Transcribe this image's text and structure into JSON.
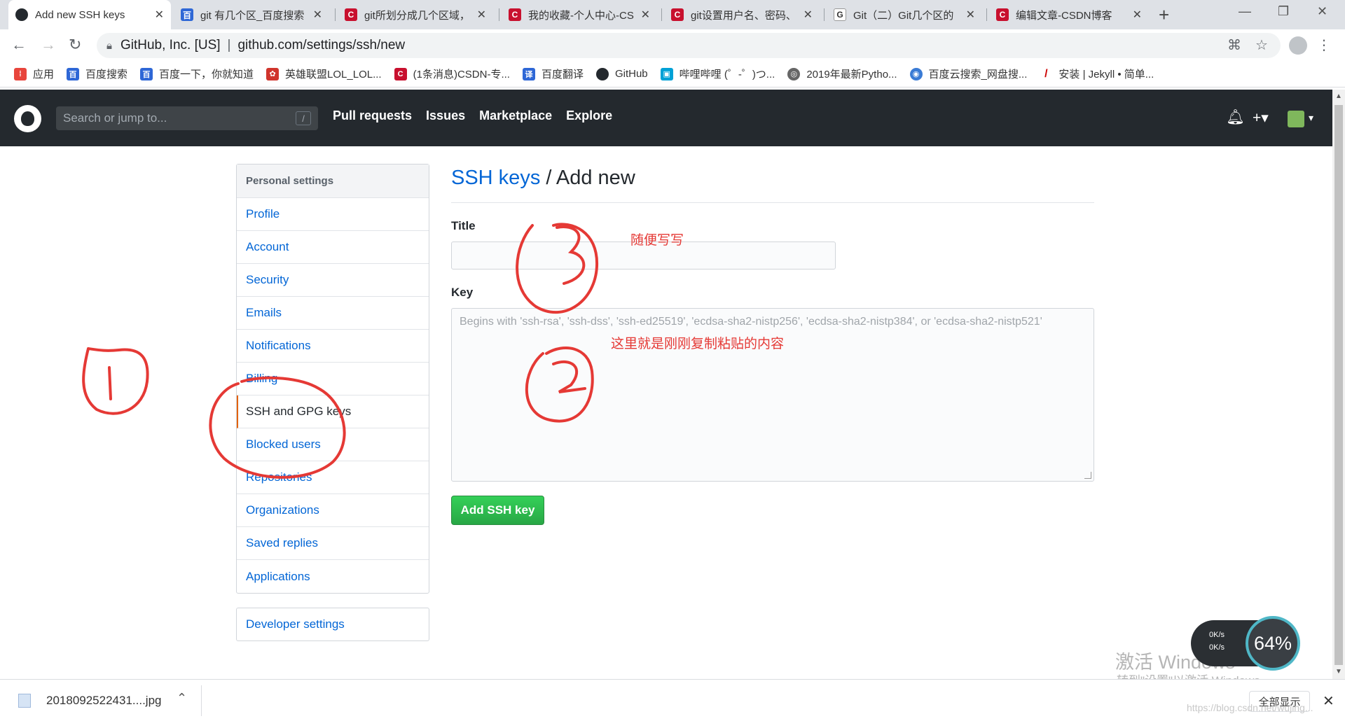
{
  "tabs": [
    {
      "title": "Add new SSH keys"
    },
    {
      "title": "git 有几个区_百度搜索"
    },
    {
      "title": "git所划分成几个区域，"
    },
    {
      "title": "我的收藏-个人中心-CS"
    },
    {
      "title": "git设置用户名、密码、"
    },
    {
      "title": "Git（二）Git几个区的"
    },
    {
      "title": "编辑文章-CSDN博客"
    }
  ],
  "address": {
    "org": "GitHub, Inc. [US]",
    "url": "github.com/settings/ssh/new"
  },
  "bookmarks": [
    {
      "label": "应用",
      "color": "#e8453c"
    },
    {
      "label": "百度搜索",
      "color": "#2e67d6"
    },
    {
      "label": "百度一下，你就知道",
      "color": "#2e67d6"
    },
    {
      "label": "英雄联盟LOL_LOL...",
      "color": "#d0342c"
    },
    {
      "label": "(1条消息)CSDN-专...",
      "color": "#c8102e"
    },
    {
      "label": "百度翻译",
      "color": "#2e67d6"
    },
    {
      "label": "GitHub",
      "color": "#24292e"
    },
    {
      "label": "哔哩哔哩 (゜-゜)つ...",
      "color": "#00a1d6"
    },
    {
      "label": "2019年最新Pytho...",
      "color": "#666666"
    },
    {
      "label": "百度云搜索_网盘搜...",
      "color": "#3a7bd5"
    },
    {
      "label": "安装 | Jekyll • 简单...",
      "color": "#cc0000"
    }
  ],
  "github": {
    "search_placeholder": "Search or jump to...",
    "search_key": "/",
    "nav": [
      "Pull requests",
      "Issues",
      "Marketplace",
      "Explore"
    ]
  },
  "menu": {
    "header": "Personal settings",
    "items": [
      "Profile",
      "Account",
      "Security",
      "Emails",
      "Notifications",
      "Billing",
      "SSH and GPG keys",
      "Blocked users",
      "Repositories",
      "Organizations",
      "Saved replies",
      "Applications"
    ],
    "developer": "Developer settings"
  },
  "page": {
    "crumb_link": "SSH keys",
    "crumb_rest": " / Add new",
    "title_label": "Title",
    "key_label": "Key",
    "key_placeholder": "Begins with 'ssh-rsa', 'ssh-dss', 'ssh-ed25519', 'ecdsa-sha2-nistp256', 'ecdsa-sha2-nistp384', or 'ecdsa-sha2-nistp521'",
    "submit": "Add SSH key"
  },
  "annotations": {
    "title_note": "随便写写",
    "key_note": "这里就是刚刚复制粘贴的内容"
  },
  "download": {
    "file": "2018092522431....jpg",
    "show_all": "全部显示"
  },
  "watermark": {
    "line1": "激活 Windows",
    "line2": "转到\"设置\"以激活 Windows。"
  },
  "netwidget": {
    "percent": "64%",
    "up": "0K/s",
    "down": "0K/s"
  },
  "footer_url": "https://blog.csdn.net/wujing..."
}
